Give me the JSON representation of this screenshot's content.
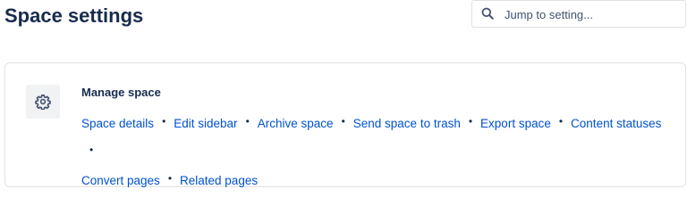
{
  "header": {
    "title": "Space settings"
  },
  "search": {
    "placeholder": "Jump to setting..."
  },
  "manage_space": {
    "heading": "Manage space",
    "icon": "gear-icon",
    "links": [
      "Space details",
      "Edit sidebar",
      "Archive space",
      "Send space to trash",
      "Export space",
      "Content statuses",
      "Convert pages",
      "Related pages"
    ]
  },
  "colors": {
    "title": "#172b4d",
    "link": "#0052cc",
    "border": "#dfe1e6",
    "icon_bg": "#f1f2f4"
  }
}
